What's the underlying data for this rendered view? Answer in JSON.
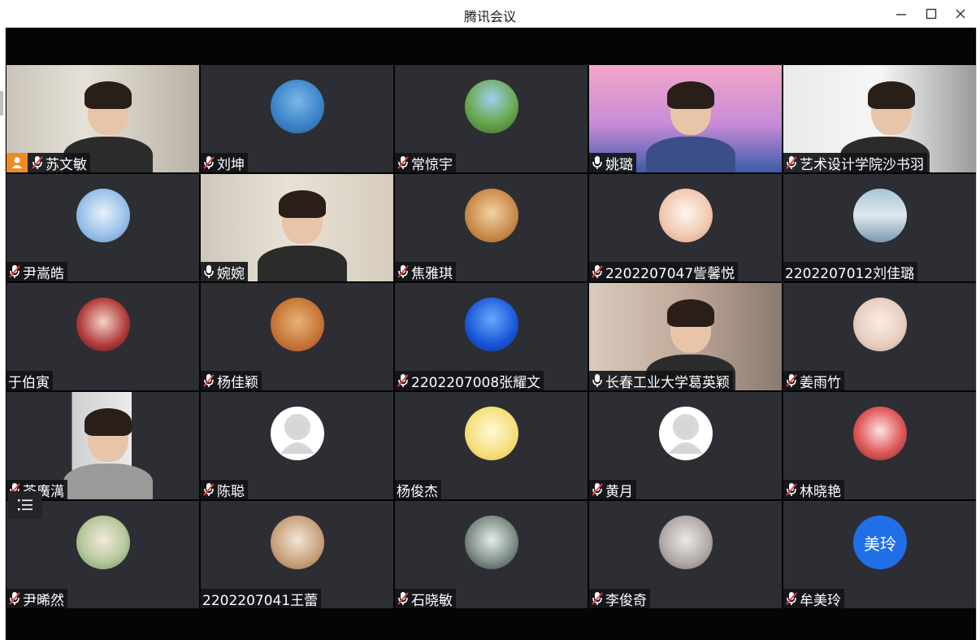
{
  "window": {
    "title": "腾讯会议"
  },
  "participants": [
    {
      "name": "苏文敏",
      "mic": "muted",
      "view": "video-room-girl",
      "cam_icon": true
    },
    {
      "name": "刘坤",
      "mic": "muted",
      "avatar": "sailboat"
    },
    {
      "name": "常惊宇",
      "mic": "muted",
      "avatar": "tree"
    },
    {
      "name": "姚璐",
      "mic": "on",
      "view": "video-pink-bg"
    },
    {
      "name": "艺术设计学院沙书羽",
      "mic": "muted",
      "view": "video-white-room"
    },
    {
      "name": "尹嵩皓",
      "mic": "muted",
      "avatar": "clouds"
    },
    {
      "name": "婉婉",
      "mic": "on",
      "view": "video-room-woman"
    },
    {
      "name": "焦雅琪",
      "mic": "muted",
      "avatar": "dog"
    },
    {
      "name": "2202207047訾馨悦",
      "mic": "muted",
      "avatar": "anime"
    },
    {
      "name": "2202207012刘佳璐",
      "mic": "none",
      "avatar": "lake"
    },
    {
      "name": "于伯寅",
      "mic": "none",
      "avatar": "girl-red"
    },
    {
      "name": "杨佳颖",
      "mic": "muted",
      "avatar": "cat"
    },
    {
      "name": "2202207008张耀文",
      "mic": "muted",
      "avatar": "blue-sky"
    },
    {
      "name": "长春工业大学葛英颖",
      "mic": "on",
      "view": "video-office"
    },
    {
      "name": "姜雨竹",
      "mic": "muted",
      "avatar": "girl-light"
    },
    {
      "name": "苓廣澫",
      "mic": "muted",
      "view": "video-man"
    },
    {
      "name": "陈聪",
      "mic": "muted",
      "avatar": "default"
    },
    {
      "name": "杨俊杰",
      "mic": "none",
      "avatar": "sketch"
    },
    {
      "name": "黄月",
      "mic": "muted",
      "avatar": "default"
    },
    {
      "name": "林晓艳",
      "mic": "muted",
      "avatar": "cartoon-red"
    },
    {
      "name": "尹晞然",
      "mic": "muted",
      "avatar": "flowers"
    },
    {
      "name": "2202207041王蕾",
      "mic": "none",
      "avatar": "hat-girl"
    },
    {
      "name": "石晓敏",
      "mic": "muted",
      "avatar": "window"
    },
    {
      "name": "李俊奇",
      "mic": "muted",
      "avatar": "cat-sleep"
    },
    {
      "name": "牟美玲",
      "mic": "muted",
      "avatar_text": "美玲"
    }
  ],
  "colors": {
    "tile": "#2c2e33",
    "accent": "#1f6fe8",
    "muted": "#e04040",
    "stage": "#050505"
  },
  "icons": {
    "minimize": "minimize-icon",
    "maximize": "maximize-icon",
    "close": "close-icon",
    "menu": "menu-list-icon"
  }
}
